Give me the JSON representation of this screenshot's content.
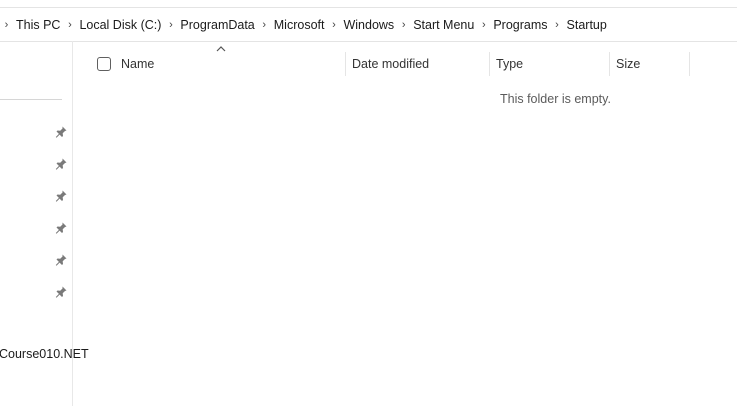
{
  "breadcrumb": {
    "items": [
      "This PC",
      "Local Disk (C:)",
      "ProgramData",
      "Microsoft",
      "Windows",
      "Start Menu",
      "Programs",
      "Startup"
    ]
  },
  "nav": {
    "partial_item": "Course010.NET"
  },
  "columns": {
    "name": "Name",
    "date_modified": "Date modified",
    "type": "Type",
    "size": "Size"
  },
  "content": {
    "empty_message": "This folder is empty."
  },
  "icons": {
    "separator": "chevron-right-icon",
    "pin": "pin-icon",
    "sort": "sort-up-icon"
  }
}
